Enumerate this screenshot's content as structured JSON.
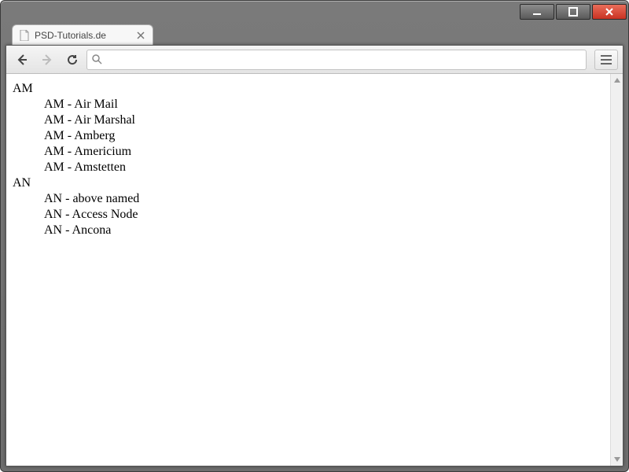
{
  "window": {
    "minimize_label": "Minimize",
    "maximize_label": "Maximize",
    "close_label": "Close"
  },
  "tab": {
    "title": "PSD-Tutorials.de"
  },
  "omnibox": {
    "value": "",
    "placeholder": ""
  },
  "content": {
    "groups": [
      {
        "heading": "AM",
        "items": [
          "AM - Air Mail",
          "AM - Air Marshal",
          "AM - Amberg",
          "AM - Americium",
          "AM - Amstetten"
        ]
      },
      {
        "heading": "AN",
        "items": [
          "AN - above named",
          "AN - Access Node",
          "AN - Ancona"
        ]
      }
    ]
  }
}
